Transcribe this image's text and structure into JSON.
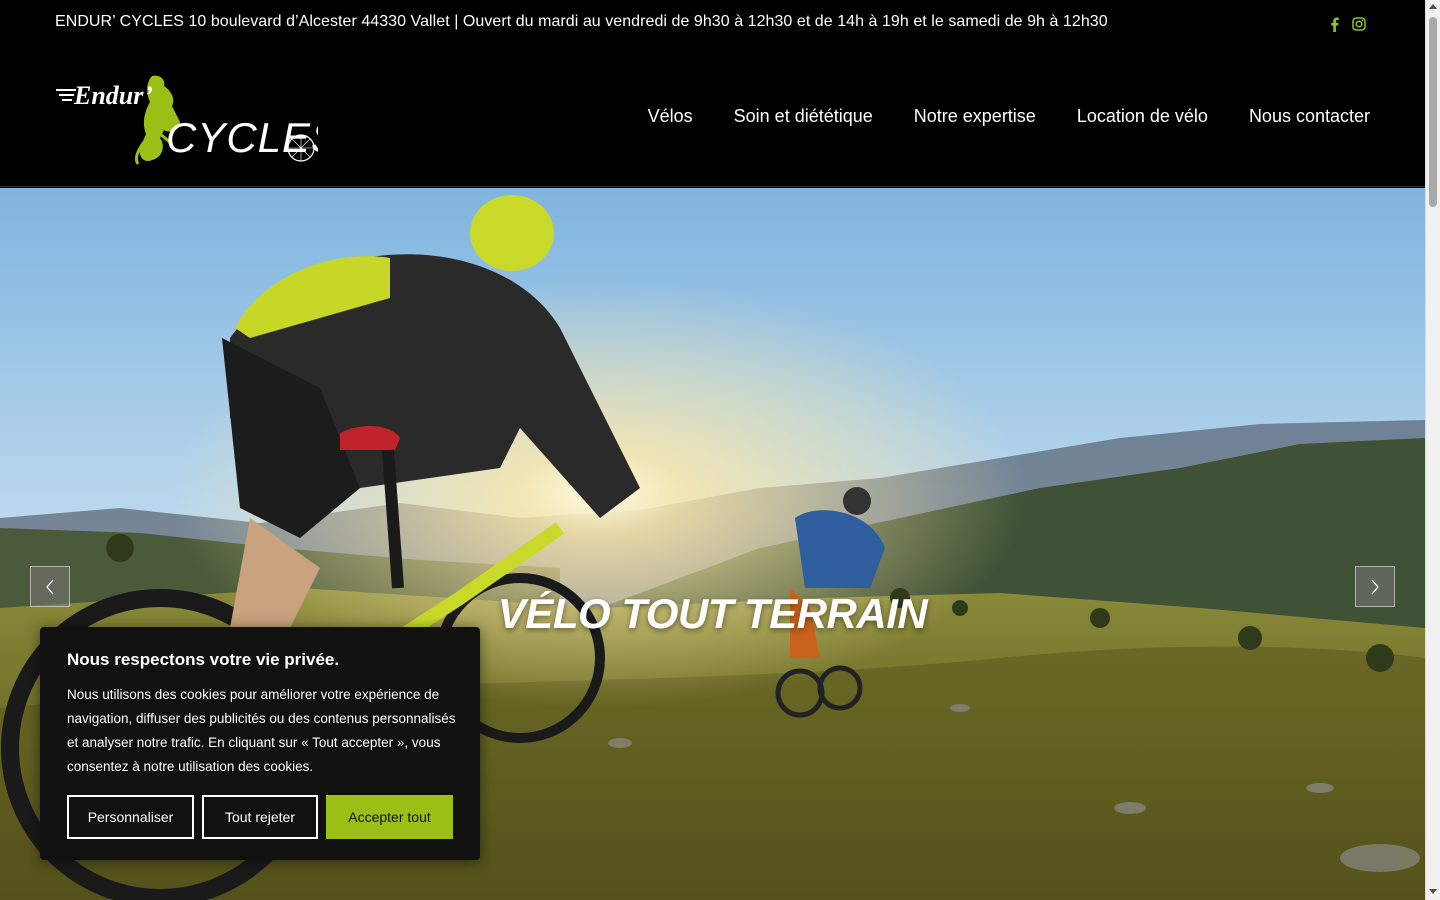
{
  "topbar": {
    "text": "ENDUR’ CYCLES 10 boulevard d’Alcester 44330 Vallet | Ouvert du mardi au vendredi de 9h30 à 12h30 et de 14h à 19h et le samedi de 9h à 12h30",
    "social": [
      {
        "icon": "facebook-icon"
      },
      {
        "icon": "instagram-icon"
      }
    ],
    "social_color": "#9bbf14"
  },
  "header": {
    "logo": {
      "word1": "Endur’",
      "word2": "CYCLES"
    },
    "nav": [
      {
        "label": "Vélos"
      },
      {
        "label": "Soin et diététique"
      },
      {
        "label": "Notre expertise"
      },
      {
        "label": "Location de vélo"
      },
      {
        "label": "Nous contacter"
      }
    ]
  },
  "hero": {
    "slide_title": "VÉLO TOUT TERRAIN",
    "prev_icon": "chevron-left-icon",
    "next_icon": "chevron-right-icon"
  },
  "cookie": {
    "title": "Nous respectons votre vie privée.",
    "body": "Nous utilisons des cookies pour améliorer votre expérience de navigation, diffuser des publicités ou des contenus personnalisés et analyser notre trafic. En cliquant sur « Tout accepter », vous consentez à notre utilisation des cookies.",
    "buttons": {
      "customize": "Personnaliser",
      "reject": "Tout rejeter",
      "accept": "Accepter tout"
    }
  },
  "colors": {
    "brand_green": "#9bbf14",
    "background": "#000000",
    "banner_bg": "#111111"
  }
}
